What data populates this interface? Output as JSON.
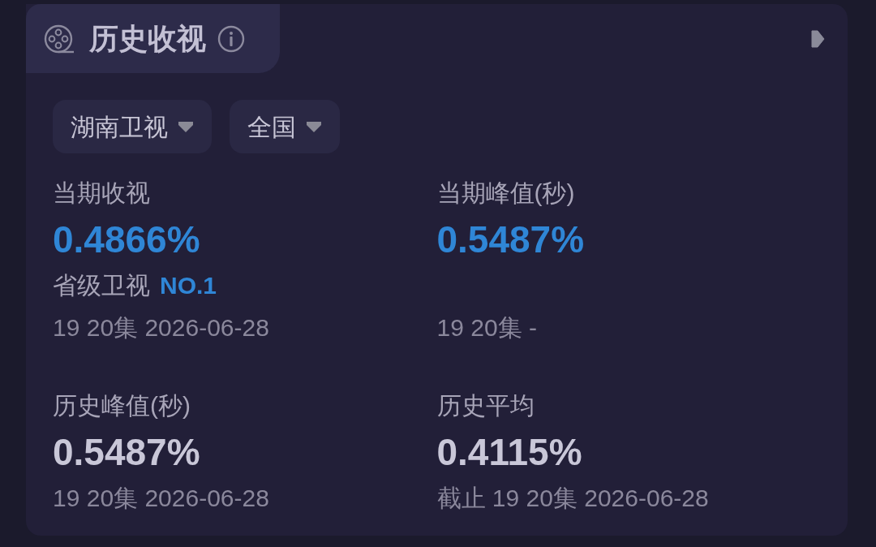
{
  "header": {
    "title": "历史收视"
  },
  "filters": [
    {
      "label": "湖南卫视"
    },
    {
      "label": "全国"
    }
  ],
  "stats": [
    {
      "label": "当期收视",
      "value": "0.4866%",
      "highlight": true,
      "rank": {
        "text": "省级卫视",
        "badge": "NO.1"
      },
      "detail": "19 20集 2026-06-28"
    },
    {
      "label": "当期峰值(秒)",
      "value": "0.5487%",
      "highlight": true,
      "detail": "19 20集 -"
    },
    {
      "label": "历史峰值(秒)",
      "value": "0.5487%",
      "highlight": false,
      "detail": "19 20集 2026-06-28"
    },
    {
      "label": "历史平均",
      "value": "0.4115%",
      "highlight": false,
      "detail": "截止 19 20集 2026-06-28"
    }
  ]
}
